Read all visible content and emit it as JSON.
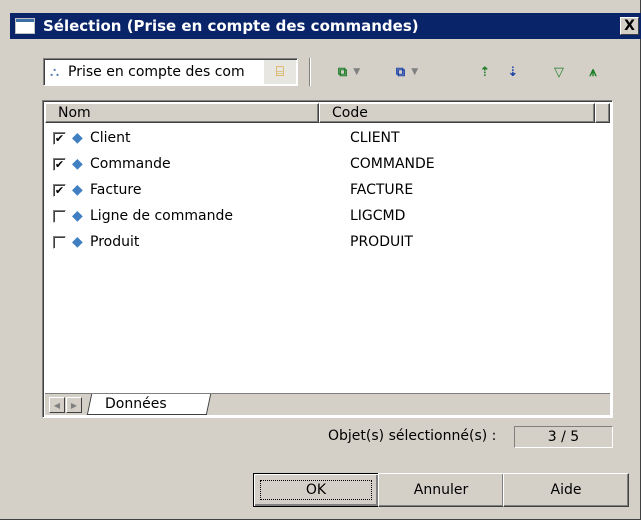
{
  "window": {
    "title": "Sélection (Prise en compte des commandes)",
    "close_glyph": "X"
  },
  "toolbar": {
    "combo_value": "Prise en compte des com",
    "icons": [
      "model-icon",
      "browse-icon",
      "select-all-icon",
      "deselect-icon",
      "move-up-icon",
      "move-down-icon",
      "filter-icon",
      "clear-filter-icon"
    ]
  },
  "list": {
    "columns": [
      "Nom",
      "Code"
    ],
    "rows": [
      {
        "name": "Client",
        "code": "CLIENT",
        "checked": true
      },
      {
        "name": "Commande",
        "code": "COMMANDE",
        "checked": true
      },
      {
        "name": "Facture",
        "code": "FACTURE",
        "checked": true
      },
      {
        "name": "Ligne de commande",
        "code": "LIGCMD",
        "checked": false
      },
      {
        "name": "Produit",
        "code": "PRODUIT",
        "checked": false
      }
    ]
  },
  "tabs": [
    {
      "label": "Données"
    }
  ],
  "status": {
    "label": "Objet(s) sélectionné(s) :",
    "value": "3 / 5"
  },
  "buttons": {
    "ok": "OK",
    "cancel": "Annuler",
    "help": "Aide"
  },
  "colors": {
    "titlebar": "#0a246a",
    "face": "#d4d0c8"
  }
}
